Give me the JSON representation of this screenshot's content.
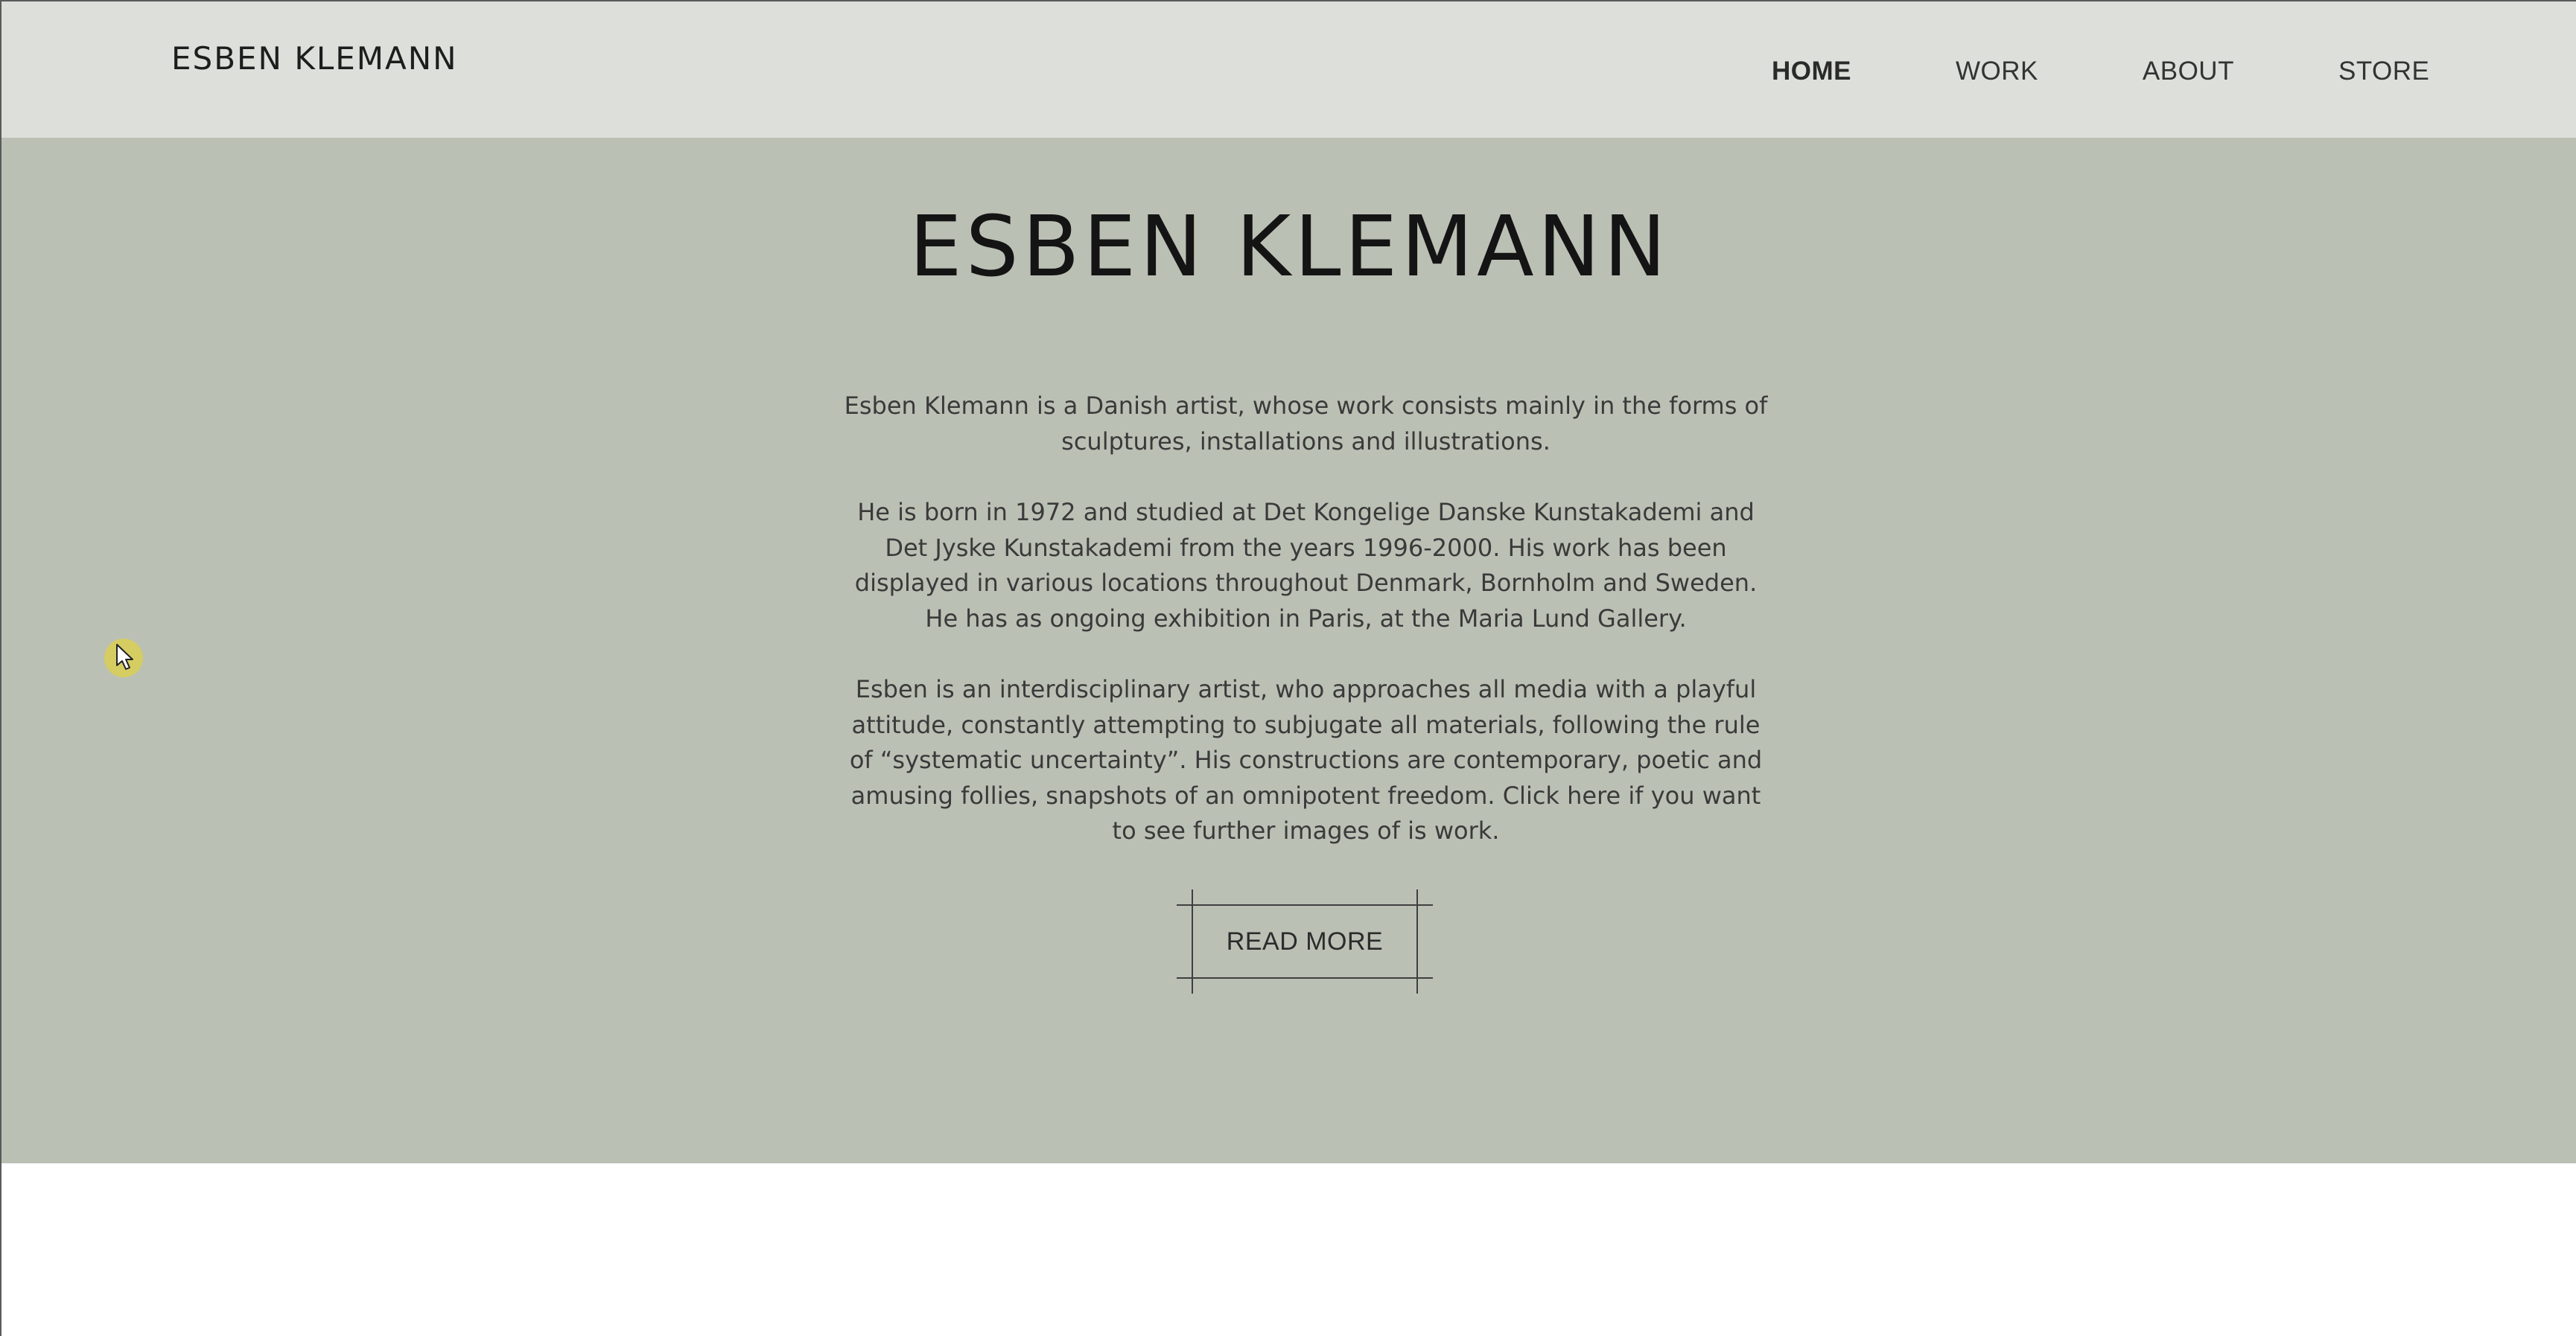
{
  "site": {
    "logo": "ESBEN KLEMANN"
  },
  "nav": {
    "items": [
      {
        "label": "HOME",
        "active": true
      },
      {
        "label": "WORK",
        "active": false
      },
      {
        "label": "ABOUT",
        "active": false
      },
      {
        "label": "STORE",
        "active": false
      }
    ]
  },
  "hero": {
    "title": "ESBEN KLEMANN",
    "paragraphs": [
      "Esben Klemann is a Danish artist, whose work consists mainly in the forms of\nsculptures, installations and illustrations.",
      "He is born in 1972 and studied at Det Kongelige Danske Kunstakademi and\nDet Jyske Kunstakademi from the years 1996-2000. His work has been\ndisplayed in various locations throughout Denmark, Bornholm and Sweden.\nHe has as ongoing exhibition in Paris, at the Maria Lund Gallery.",
      "Esben is an interdisciplinary artist, who approaches all media with a playful\nattitude, constantly attempting to subjugate all materials, following the rule\nof “systematic uncertainty”. His constructions are contemporary, poetic and\namusing follies, snapshots of an omnipotent freedom. Click here if you want\nto see further images of is work."
    ],
    "button_label": "READ MORE"
  },
  "colors": {
    "header_bg": "#dde0da",
    "hero_bg": "#bbc0b5",
    "page_bg": "#ffffff",
    "cursor_highlight": "#ded246"
  },
  "icons": {
    "cursor": "mouse-pointer-icon"
  }
}
